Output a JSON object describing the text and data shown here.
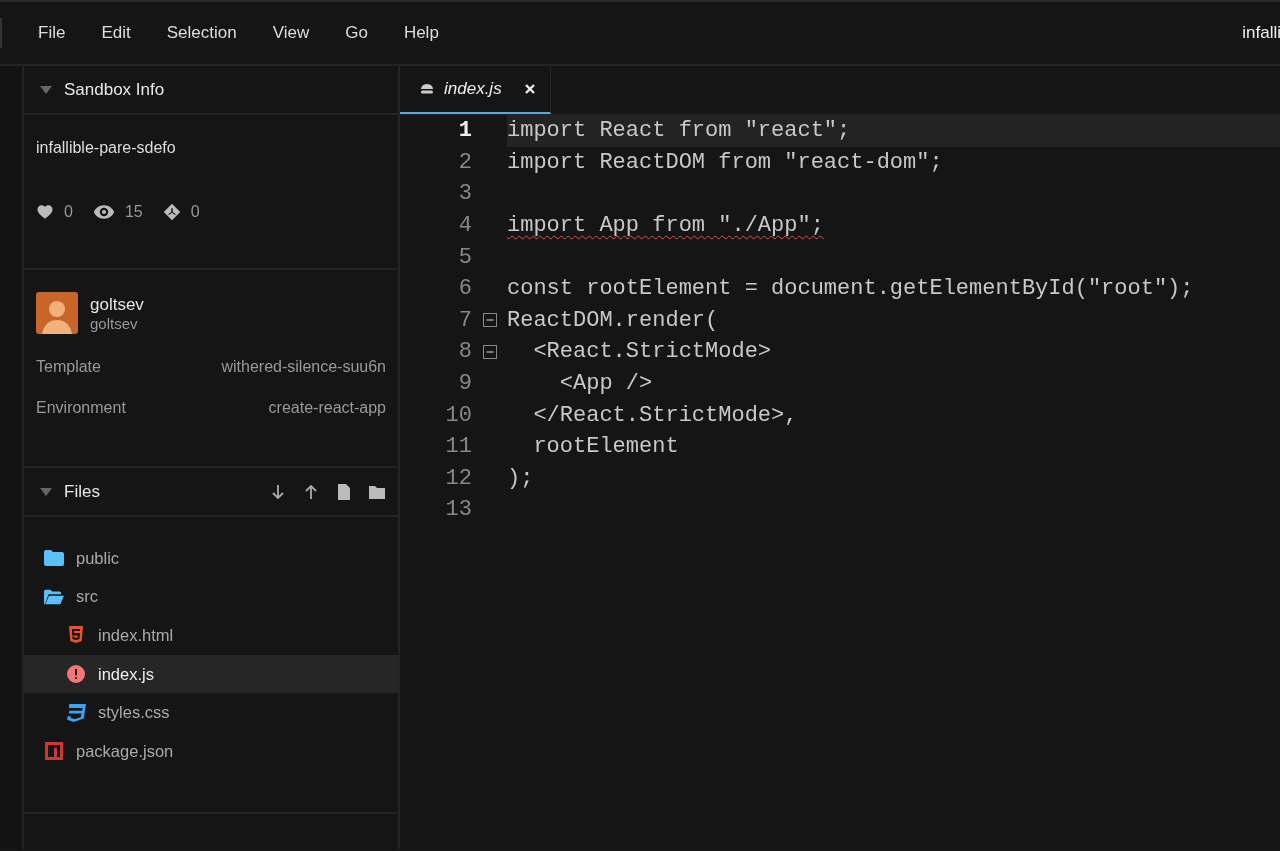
{
  "menu": [
    {
      "label": "File"
    },
    {
      "label": "Edit"
    },
    {
      "label": "Selection"
    },
    {
      "label": "View"
    },
    {
      "label": "Go"
    },
    {
      "label": "Help"
    }
  ],
  "window": {
    "title": "infalli"
  },
  "sandbox_info": {
    "header": "Sandbox Info",
    "expanded": true,
    "name": "infallible-pare-sdefo",
    "stats": [
      {
        "kind": "likes",
        "value": "0"
      },
      {
        "kind": "views",
        "value": "15"
      },
      {
        "kind": "forks",
        "value": "0"
      }
    ]
  },
  "author": {
    "name": "goltsev",
    "username": "goltsev"
  },
  "details": [
    {
      "label": "Template",
      "value": "withered-silence-suu6n"
    },
    {
      "label": "Environment",
      "value": "create-react-app"
    }
  ],
  "files": {
    "header": "Files",
    "expanded": true,
    "items": [
      {
        "name": "public",
        "kind": "folder",
        "selected": false
      },
      {
        "name": "src",
        "kind": "folder_open",
        "selected": false,
        "children": [
          {
            "name": "index.html",
            "kind": "html",
            "selected": false
          },
          {
            "name": "index.js",
            "kind": "error",
            "selected": true
          },
          {
            "name": "styles.css",
            "kind": "css",
            "selected": false
          }
        ]
      },
      {
        "name": "package.json",
        "kind": "npm",
        "selected": false
      }
    ]
  },
  "editor": {
    "tabs": [
      {
        "label": "index.js",
        "selected": true
      }
    ],
    "lines": [
      {
        "number": "1",
        "text": "import React from \"react\";",
        "current": true,
        "foldable": false,
        "error": false
      },
      {
        "number": "2",
        "text": "import ReactDOM from \"react-dom\";",
        "current": false,
        "foldable": false,
        "error": false
      },
      {
        "number": "3",
        "current": false,
        "foldable": false
      },
      {
        "number": "4",
        "text": "import App from \"./App\";",
        "current": false,
        "foldable": false,
        "error": true
      },
      {
        "number": "5",
        "current": false,
        "foldable": false
      },
      {
        "number": "6",
        "text": "const rootElement = document.getElementById(\"root\");",
        "current": false,
        "foldable": false,
        "error": false
      },
      {
        "number": "7",
        "text": "ReactDOM.render(",
        "current": false,
        "foldable": true,
        "error": false
      },
      {
        "number": "8",
        "text": "  <React.StrictMode>",
        "current": false,
        "foldable": true,
        "error": false
      },
      {
        "number": "9",
        "text": "    <App />",
        "current": false,
        "foldable": false,
        "error": false
      },
      {
        "number": "10",
        "text": "  </React.StrictMode>,",
        "current": false,
        "foldable": false,
        "error": false
      },
      {
        "number": "11",
        "text": "  rootElement",
        "current": false,
        "foldable": false,
        "error": false
      },
      {
        "number": "12",
        "text": ");",
        "current": false,
        "foldable": false,
        "error": false
      },
      {
        "number": "13",
        "current": false,
        "foldable": false
      }
    ]
  }
}
